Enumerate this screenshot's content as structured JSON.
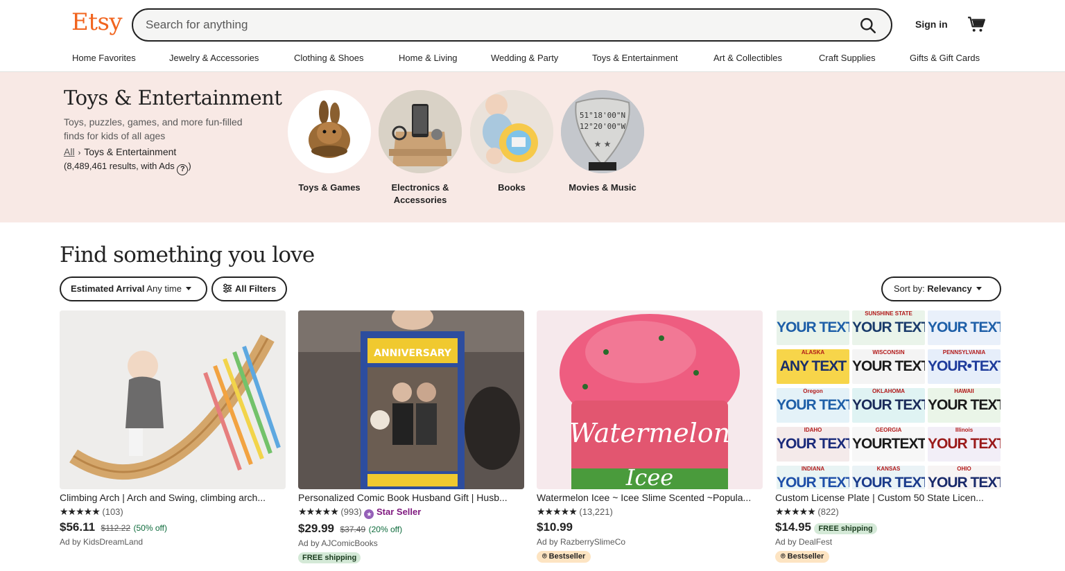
{
  "header": {
    "logo": "Etsy",
    "search_placeholder": "Search for anything",
    "signin": "Sign in",
    "brand_color": "#f1641e"
  },
  "nav": [
    "Home Favorites",
    "Jewelry & Accessories",
    "Clothing & Shoes",
    "Home & Living",
    "Wedding & Party",
    "Toys & Entertainment",
    "Art & Collectibles",
    "Craft Supplies",
    "Gifts & Gift Cards"
  ],
  "banner": {
    "title": "Toys & Entertainment",
    "subtitle": "Toys, puzzles, games, and more fun-filled finds for kids of all ages",
    "crumb_all": "All",
    "crumb_current": "Toys & Entertainment",
    "results_prefix": "(8,489,461 results, with Ads",
    "results_suffix": ")",
    "background": "#f8e9e5",
    "categories": [
      {
        "label": "Toys & Games",
        "icon": "bunny-plush-icon"
      },
      {
        "label": "Electronics & Accessories",
        "icon": "phone-stand-icon"
      },
      {
        "label": "Books",
        "icon": "baby-book-icon"
      },
      {
        "label": "Movies & Music",
        "icon": "guitar-pick-icon"
      }
    ]
  },
  "find": {
    "title": "Find something you love",
    "arrival_label": "Estimated Arrival",
    "arrival_value": "Any time",
    "all_filters": "All Filters",
    "sort_label": "Sort by:",
    "sort_value": "Relevancy"
  },
  "products": [
    {
      "title": "Climbing Arch | Arch and Swing, climbing arch...",
      "stars": "★★★★★",
      "reviews": "(103)",
      "price": "$56.11",
      "old_price": "$112.22",
      "discount": "(50% off)",
      "byline": "Ad by KidsDreamLand"
    },
    {
      "title": "Personalized Comic Book Husband Gift | Husb...",
      "stars": "★★★★★",
      "reviews": "(993)",
      "star_seller": "Star Seller",
      "price": "$29.99",
      "old_price": "$37.49",
      "discount": "(20% off)",
      "byline": "Ad by AJComicBooks",
      "badge": "FREE shipping",
      "cover_text": "ANNIVERSARY"
    },
    {
      "title": "Watermelon Icee ~ Icee Slime Scented ~Popula...",
      "stars": "★★★★★",
      "reviews": "(13,221)",
      "price": "$10.99",
      "byline": "Ad by RazberrySlimeCo",
      "badge": "Bestseller",
      "jar_text_1": "Watermelon",
      "jar_text_2": "Icee"
    },
    {
      "title": "Custom License Plate | Custom 50 State Licen...",
      "stars": "★★★★★",
      "reviews": "(822)",
      "price": "$14.95",
      "inline_badge": "FREE shipping",
      "byline": "Ad by DealFest",
      "badge": "Bestseller",
      "plates": [
        {
          "state": "",
          "text": "YOUR TEXT"
        },
        {
          "state": "SUNSHINE STATE",
          "text": "YOUR TEXT"
        },
        {
          "state": "",
          "text": "YOUR TEXT"
        },
        {
          "state": "ALASKA",
          "text": "ANY TEXT"
        },
        {
          "state": "WISCONSIN",
          "text": "YOUR TEXT"
        },
        {
          "state": "PENNSYLVANIA",
          "text": "YOUR•TEXT"
        },
        {
          "state": "Oregon",
          "text": "YOUR TEXT"
        },
        {
          "state": "OKLAHOMA",
          "text": "YOUR TEXT"
        },
        {
          "state": "HAWAII",
          "text": "YOUR TEXT"
        },
        {
          "state": "IDAHO",
          "text": "YOUR TEXT"
        },
        {
          "state": "GEORGIA",
          "text": "YOURTEXT"
        },
        {
          "state": "Illinois",
          "text": "YOUR TEXT"
        },
        {
          "state": "INDIANA",
          "text": "YOUR TEXT"
        },
        {
          "state": "KANSAS",
          "text": "YOUR TEXT"
        },
        {
          "state": "OHIO",
          "text": "YOUR TEXT"
        }
      ]
    }
  ]
}
